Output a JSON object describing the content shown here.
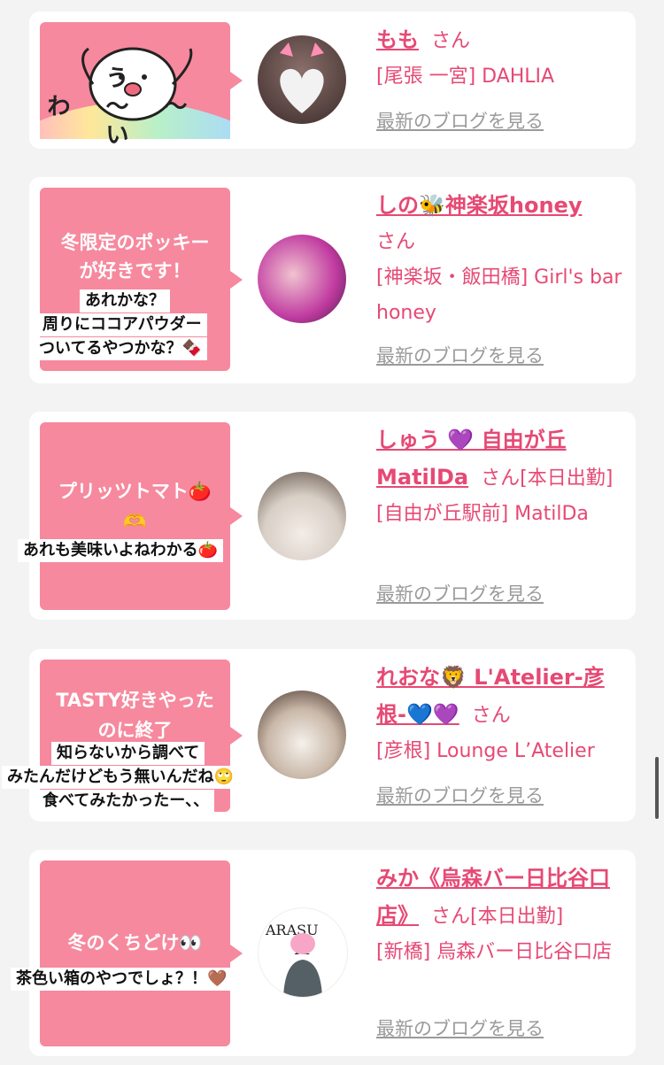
{
  "colors": {
    "accent": "#e64974",
    "bubble": "#f6899e",
    "muted": "#9a9a9a"
  },
  "blog_link_label": "最新のブログを見る",
  "posts": [
    {
      "bubble_lines": [
        "うわ〜〜い"
      ],
      "name": "もも",
      "san": "さん",
      "meta": "[尾張 一宮] DAHLIA",
      "overlay": []
    },
    {
      "bubble_lines": [
        "冬限定のポッキー",
        "が好きです！"
      ],
      "name": "しの🐝神楽坂honey",
      "san": "さん",
      "meta": "[神楽坂・飯田橋] Girl's bar honey",
      "overlay": [
        "あれかな？",
        "周りにココアパウダー",
        "ついてるやつかな？🍫"
      ]
    },
    {
      "bubble_lines": [
        "プリッツトマト🍅",
        "🫶"
      ],
      "name": "しゅう 💜 自由が丘 MatilDa",
      "san": "さん[本日出勤]",
      "meta": "[自由が丘駅前] MatilDa",
      "overlay": [
        "あれも美味いよねわかる🍅"
      ]
    },
    {
      "bubble_lines": [
        "TASTY好きやった",
        "のに終了"
      ],
      "name": "れおな🦁 L'Atelier-彦根-💙💜",
      "san": "さん",
      "meta": "[彦根] Lounge L’Atelier",
      "overlay": [
        "知らないから調べて",
        "みたんだけどもう無いんだね🙄",
        "食べてみたかったー、、"
      ]
    },
    {
      "bubble_lines": [
        "冬のくちどけ👀"
      ],
      "name": "みか《烏森バー日比谷口店》",
      "san": "さん[本日出勤]",
      "meta": "[新橋] 烏森バー日比谷口店",
      "overlay": [
        "茶色い箱のやつでしょ？！🤎"
      ]
    }
  ]
}
